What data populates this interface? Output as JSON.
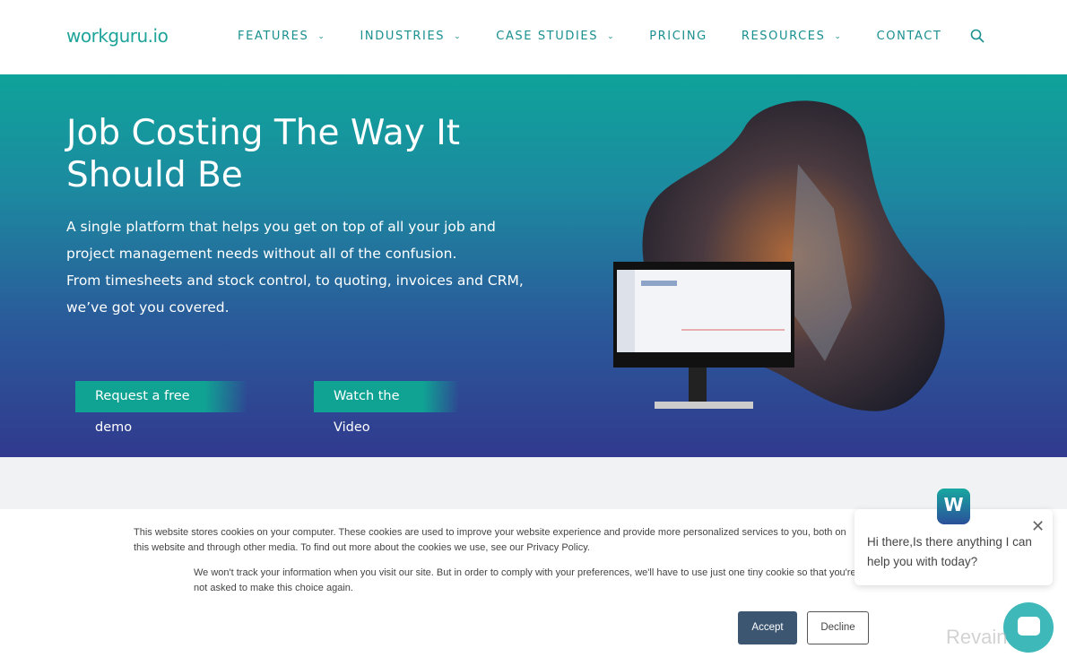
{
  "header": {
    "logo": "workguru.io",
    "nav": [
      {
        "label": "FEATURES",
        "dropdown": true
      },
      {
        "label": "INDUSTRIES",
        "dropdown": true
      },
      {
        "label": "CASE STUDIES",
        "dropdown": true
      },
      {
        "label": "PRICING",
        "dropdown": false
      },
      {
        "label": "RESOURCES",
        "dropdown": true
      },
      {
        "label": "CONTACT",
        "dropdown": false
      }
    ],
    "search_icon": "search-icon"
  },
  "hero": {
    "title_line1": "Job Costing The Way It",
    "title_line2": "Should Be",
    "subtitle_lines": [
      "A single platform that helps you get on top of all your job and",
      "project management needs without all of the confusion.",
      "From timesheets and stock control, to quoting, invoices and CRM,",
      "we’ve got you covered."
    ],
    "demo_button": "Request a free demo",
    "video_button": "Watch the Video"
  },
  "cookie": {
    "text1": "This website stores cookies on your computer. These cookies are used to improve your website experience and provide more personalized services to you, both on this website and through other media. To find out more about the cookies we use, see our Privacy Policy.",
    "text2": "We won't track your information when you visit our site. But in order to comply with your preferences, we'll have to use just one tiny cookie so that you're not asked to make this choice again.",
    "accept": "Accept",
    "decline": "Decline"
  },
  "chat": {
    "avatar_letter": "W",
    "message": "Hi there,Is there anything I can help you with today?"
  },
  "watermark": "Revain",
  "colors": {
    "brand": "#1ea49a",
    "hero_top": "#0fa39a",
    "hero_bottom": "#313a8e",
    "accept": "#3c5672",
    "chat": "#3fb8ba"
  }
}
